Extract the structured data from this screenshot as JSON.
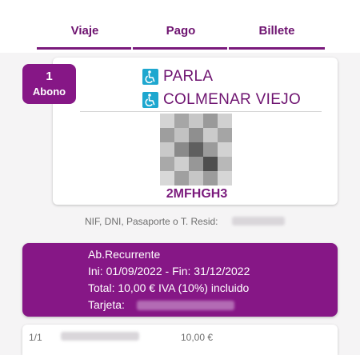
{
  "tabs": [
    {
      "label": "Viaje"
    },
    {
      "label": "Pago"
    },
    {
      "label": "Billete",
      "active": true
    }
  ],
  "ticket": {
    "quantity": "1",
    "type": "Abono",
    "origin": "PARLA",
    "destination": "COLMENAR VIEJO",
    "code": "2MFHGH3",
    "accessibility_icon": "wheelchair-icon"
  },
  "document": {
    "label": "NIF, DNI, Pasaporte o T. Resid:"
  },
  "summary": {
    "product": "Ab.Recurrente",
    "validity": "Ini: 01/09/2022 - Fin: 31/12/2022",
    "total": "Total: 10,00 € IVA (10%) incluido",
    "card_label": "Tarjeta:"
  },
  "line_item": {
    "index": "1/1",
    "amount": "10,00 €"
  },
  "colors": {
    "brand_purple": "#861786",
    "text_purple": "#6e1370",
    "accessibility_blue": "#1ea7cf"
  }
}
